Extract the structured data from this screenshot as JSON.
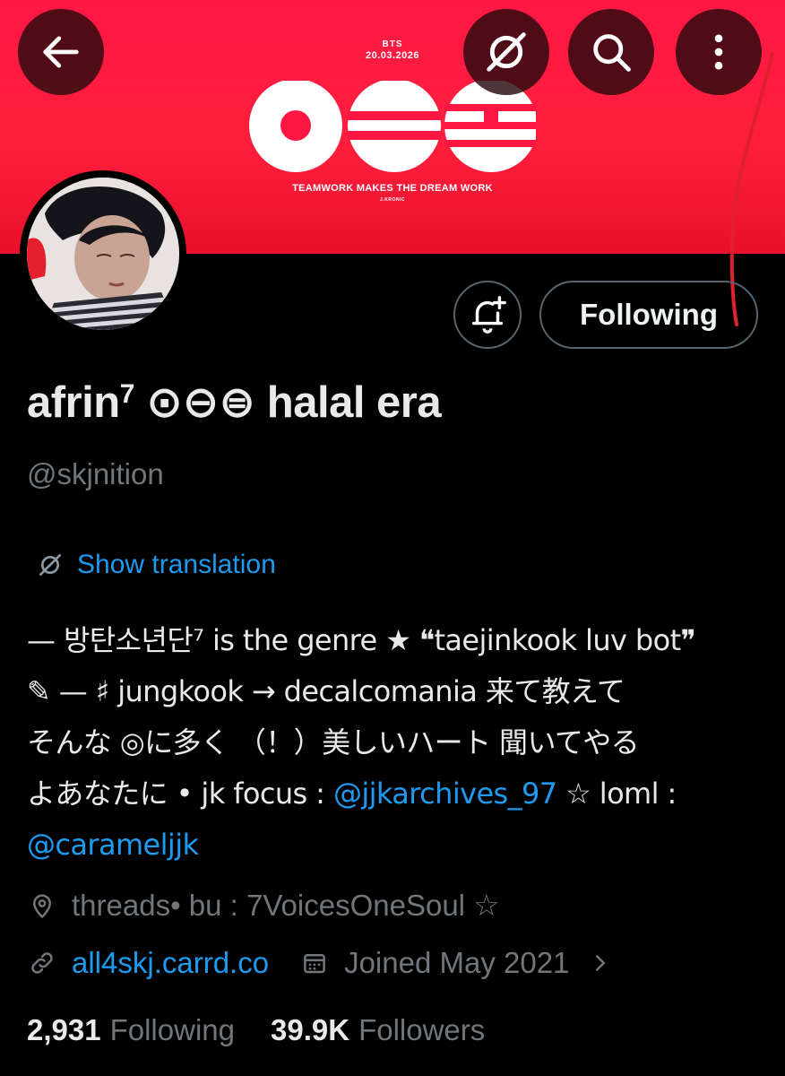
{
  "banner": {
    "artist": "BTS",
    "date": "20.03.2026",
    "slogan": "TEAMWORK MAKES THE DREAM WORK",
    "credit": "J.KRONIC",
    "colors": {
      "background": "#ff1744",
      "foreground": "#ffffff"
    }
  },
  "toolbar": {
    "back_icon": "arrow-left-icon",
    "translate_icon": "translate-slash-icon",
    "search_icon": "search-icon",
    "more_icon": "more-vertical-icon"
  },
  "profile": {
    "avatar_icon": "avatar",
    "notify_icon": "bell-plus-icon",
    "follow_button_label": "Following",
    "display_name": "afrin",
    "display_name_sup": "7",
    "display_name_rest": " ⊙⊖⊜ halal era",
    "handle": "@skjnition"
  },
  "translation": {
    "label": "Show translation"
  },
  "bio": {
    "line1": "— 방탄소년단⁷ is the genre ★ ❝taejinkook luv bot❞",
    "line2": "✎ — ♯ jungkook → decalcomania 来て教えて",
    "line3": "そんな ◎に多く （！）美しいハート 聞いてやる",
    "line4_prefix": "よあなたに • jk focus : ",
    "line4_mention": "@jjkarchives_97",
    "line4_suffix": " ☆ loml :",
    "line5_mention": "@carameljjk"
  },
  "meta": {
    "location": "threads• bu : 7VoicesOneSoul ☆",
    "website": "all4skj.carrd.co",
    "joined": "Joined May 2021"
  },
  "counts": {
    "following_value": "2,931",
    "following_label": "Following",
    "followers_value": "39.9K",
    "followers_label": "Followers"
  },
  "colors": {
    "link": "#1d9bf0",
    "muted": "#71767b",
    "text": "#e7e9ea",
    "accent_red": "#ff1744"
  }
}
